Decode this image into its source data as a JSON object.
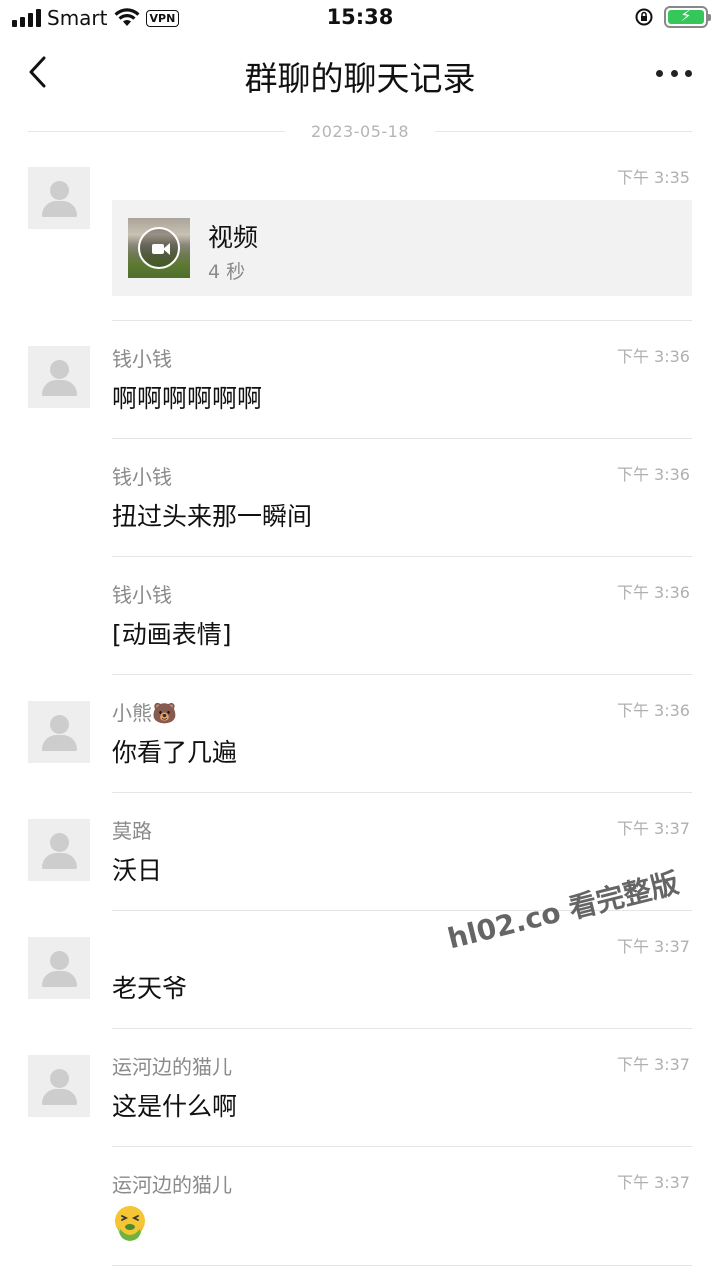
{
  "status_bar": {
    "carrier": "Smart",
    "vpn": "VPN",
    "time": "15:38",
    "battery_color": "#35c759"
  },
  "nav": {
    "title": "群聊的聊天记录",
    "back_icon": "chevron-left-icon",
    "more_icon": "more-horizontal-icon"
  },
  "date_divider": "2023-05-18",
  "messages": [
    {
      "sender": "",
      "time": "下午 3:35",
      "type": "video",
      "video_title": "视频",
      "video_duration": "4 秒"
    },
    {
      "sender": "钱小钱",
      "time": "下午 3:36",
      "text": "啊啊啊啊啊啊"
    },
    {
      "sender": "钱小钱",
      "time": "下午 3:36",
      "text": "扭过头来那一瞬间"
    },
    {
      "sender": "钱小钱",
      "time": "下午 3:36",
      "text": "[动画表情]"
    },
    {
      "sender": "小熊🐻",
      "time": "下午 3:36",
      "text": "你看了几遍"
    },
    {
      "sender": "莫路",
      "time": "下午 3:37",
      "text": "沃日"
    },
    {
      "sender": "",
      "time": "下午 3:37",
      "text": "老天爷"
    },
    {
      "sender": "运河边的猫儿",
      "time": "下午 3:37",
      "text": "这是什么啊"
    },
    {
      "sender": "运河边的猫儿",
      "time": "下午 3:37",
      "type": "emoji",
      "emoji": "vomiting-face"
    }
  ],
  "watermark": "hl02.co 看完整版"
}
